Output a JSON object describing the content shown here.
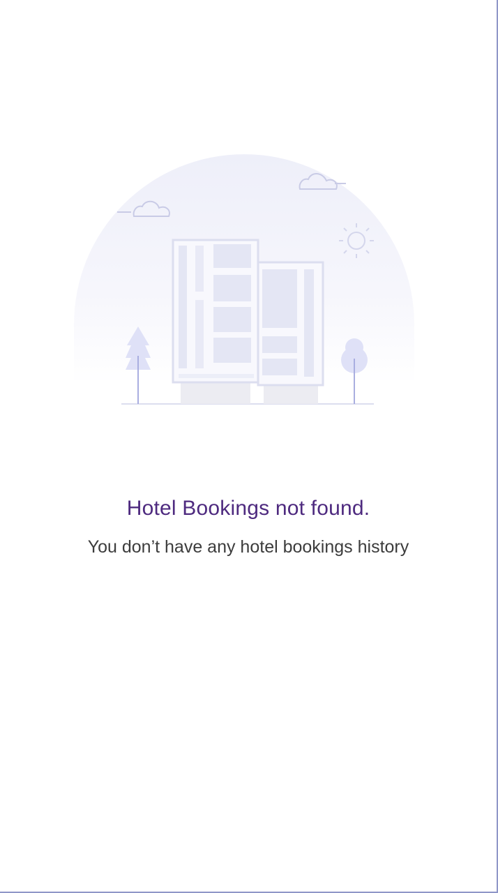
{
  "empty_state": {
    "title": "Hotel Bookings not found.",
    "message": "You don’t have any hotel bookings history",
    "illustration_icon": "hotel-building-icon"
  },
  "colors": {
    "title": "#4e2a7f",
    "message": "#3c3c3c",
    "illustration_tint": "#e9eaf7",
    "illustration_accent": "#a9aee0",
    "frame_border": "#8f96c8"
  }
}
